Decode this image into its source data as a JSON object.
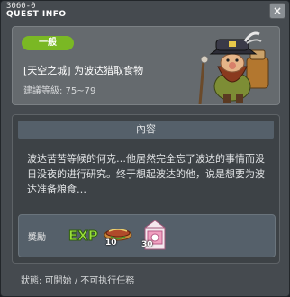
{
  "window": {
    "id": "3060-0",
    "title": "QUEST INFO",
    "close_label": "×"
  },
  "quest": {
    "category": "一般",
    "name": "[天空之城] 为波达猎取食物",
    "level": "建議等級: 75~79"
  },
  "content": {
    "header": "內容",
    "description": "波达苦苦等候的何克…他居然完全忘了波达的事情而没日没夜的进行研究。终于想起波达的他，说是想要为波达准备粮食…"
  },
  "reward": {
    "label": "獎勵",
    "exp_text": "EXP",
    "items": [
      {
        "icon": "sausage-icon",
        "quantity": "10"
      },
      {
        "icon": "milk-carton-icon",
        "quantity": "30"
      }
    ]
  },
  "status": "狀態: 可開始 / 不可执行任務",
  "colors": {
    "category_pill": "#7ab824",
    "exp": "#9be03a"
  }
}
